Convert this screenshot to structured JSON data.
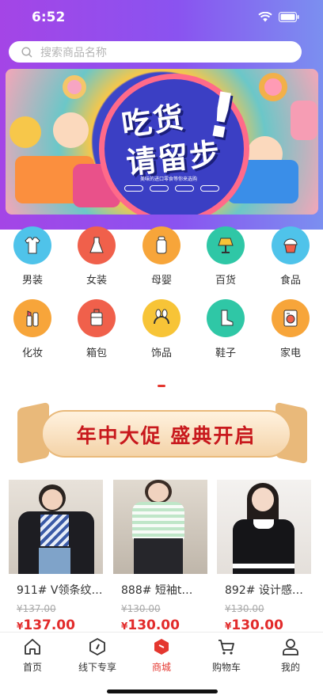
{
  "status_bar": {
    "time": "6:52"
  },
  "search": {
    "placeholder": "搜索商品名称"
  },
  "banner": {
    "title_line1": "吃货",
    "title_line2": "请留步",
    "exclaim": "!",
    "subtitle": "美味的进口零食等你来选购"
  },
  "categories": [
    {
      "label": "男装",
      "icon": "shirt-icon",
      "color": "#4fc3ea"
    },
    {
      "label": "女装",
      "icon": "dress-icon",
      "color": "#f0604b"
    },
    {
      "label": "母婴",
      "icon": "bottle-icon",
      "color": "#f7a53a"
    },
    {
      "label": "百货",
      "icon": "lamp-icon",
      "color": "#2fc7a6"
    },
    {
      "label": "食品",
      "icon": "cupcake-icon",
      "color": "#4fc3ea"
    },
    {
      "label": "化妆",
      "icon": "cosmetics-icon",
      "color": "#f7a53a"
    },
    {
      "label": "箱包",
      "icon": "luggage-icon",
      "color": "#f0604b"
    },
    {
      "label": "饰品",
      "icon": "hairband-icon",
      "color": "#f7c437"
    },
    {
      "label": "鞋子",
      "icon": "boot-icon",
      "color": "#2fc7a6"
    },
    {
      "label": "家电",
      "icon": "washer-icon",
      "color": "#f7a53a"
    }
  ],
  "promo": {
    "text": "年中大促  盛典开启"
  },
  "products": [
    {
      "name": "911# V领条纹…",
      "old_price": "¥137.00",
      "currency": "¥",
      "price": "137.00"
    },
    {
      "name": "888# 短袖t…",
      "old_price": "¥130.00",
      "currency": "¥",
      "price": "130.00"
    },
    {
      "name": "892# 设计感…",
      "old_price": "¥130.00",
      "currency": "¥",
      "price": "130.00"
    }
  ],
  "tabbar": {
    "items": [
      {
        "label": "首页",
        "icon": "home-icon"
      },
      {
        "label": "线下专享",
        "icon": "compass-icon"
      },
      {
        "label": "商城",
        "icon": "store-icon",
        "active": true
      },
      {
        "label": "购物车",
        "icon": "cart-icon"
      },
      {
        "label": "我的",
        "icon": "user-icon"
      }
    ]
  },
  "colors": {
    "accent": "#e4372f",
    "header_start": "#a445e6",
    "header_end": "#7b8ff0"
  }
}
